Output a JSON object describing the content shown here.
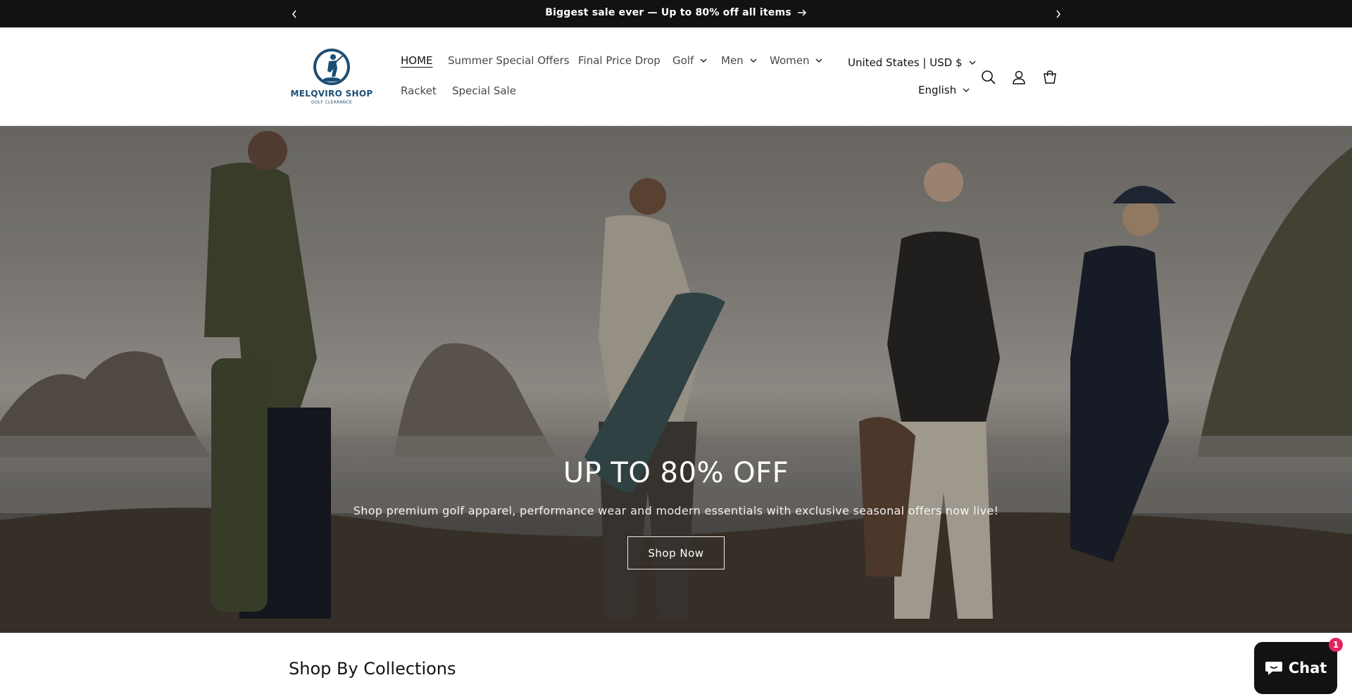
{
  "announcement": {
    "text": "Biggest sale ever — Up to 80% off all items",
    "prev_icon": "chevron-left-icon",
    "next_icon": "chevron-right-icon"
  },
  "header": {
    "logo": {
      "brand": "MELQVIRO SHOP",
      "tagline": "GOLF CLEARANCE"
    },
    "nav": [
      {
        "label": "HOME",
        "active": true
      },
      {
        "label": "Summer Special Offers"
      },
      {
        "label": "Final Price Drop"
      },
      {
        "label": "Golf",
        "dropdown": true
      },
      {
        "label": "Men",
        "dropdown": true
      },
      {
        "label": "Women",
        "dropdown": true
      },
      {
        "label": "Racket"
      },
      {
        "label": "Special Sale"
      }
    ],
    "country": "United States | USD $",
    "language": "English",
    "icons": [
      "search-icon",
      "account-icon",
      "cart-icon"
    ]
  },
  "hero": {
    "title": "UP TO 80% OFF",
    "subtitle": "Shop premium golf apparel, performance wear and modern essentials with exclusive seasonal offers now live!",
    "button": "Shop Now"
  },
  "collections": {
    "title": "Shop By Collections"
  },
  "chat": {
    "label": "Chat",
    "badge": "1"
  },
  "colors": {
    "announcement_bg": "#121212",
    "logo_blue": "#1d4e73",
    "badge": "#e0245e"
  }
}
